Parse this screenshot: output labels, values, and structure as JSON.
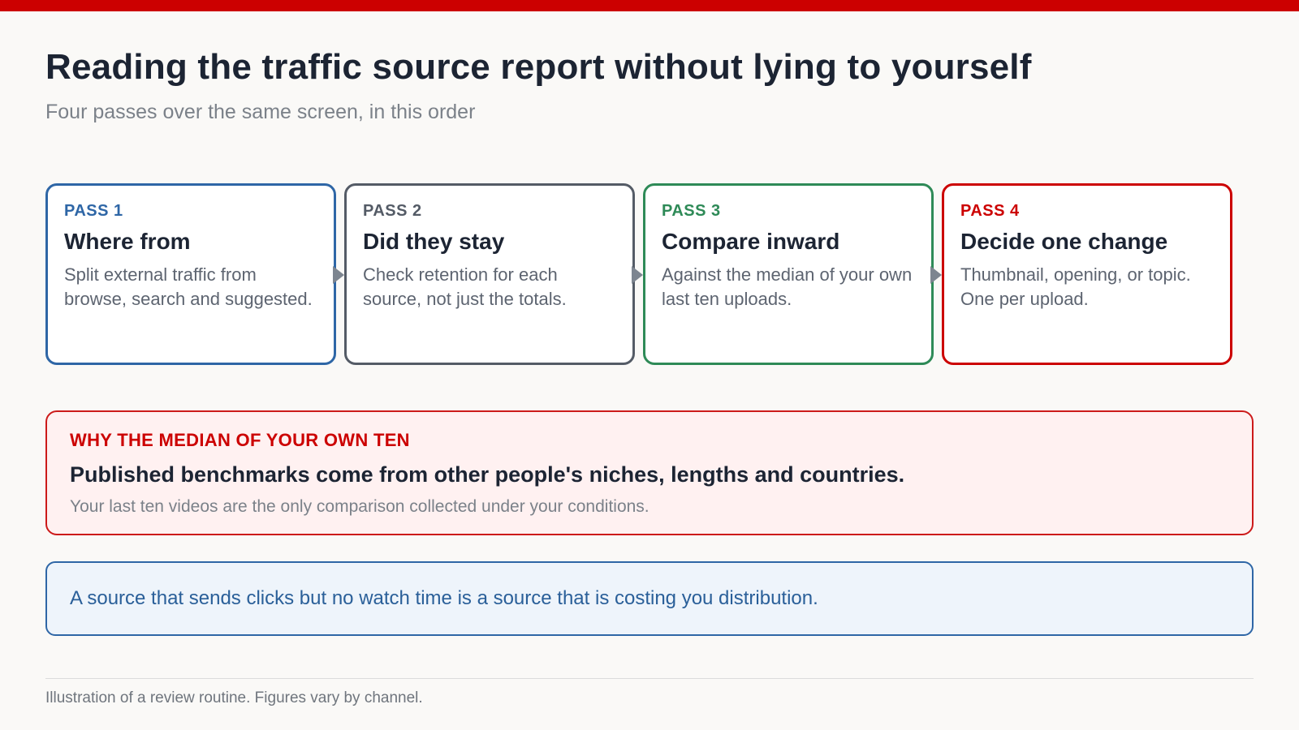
{
  "header": {
    "title": "Reading the traffic source report without lying to yourself",
    "subtitle": "Four passes over the same screen, in this order"
  },
  "passes": [
    {
      "label": "PASS 1",
      "title": "Where from",
      "desc": "Split external traffic from browse, search and suggested.",
      "color": "#2e66a6"
    },
    {
      "label": "PASS 2",
      "title": "Did they stay",
      "desc": "Check retention for each source, not just the totals.",
      "color": "#545b66"
    },
    {
      "label": "PASS 3",
      "title": "Compare inward",
      "desc": "Against the median of your own last ten uploads.",
      "color": "#2e8a57"
    },
    {
      "label": "PASS 4",
      "title": "Decide one change",
      "desc": "Thumbnail, opening, or topic. One per upload.",
      "color": "#cc0000"
    }
  ],
  "callout": {
    "label": "WHY THE MEDIAN OF YOUR OWN TEN",
    "headline": "Published benchmarks come from other people's niches, lengths and countries.",
    "body": "Your last ten videos are the only comparison collected under your conditions."
  },
  "note": {
    "text": "A source that sends clicks but no watch time is a source that is costing you distribution."
  },
  "footer": {
    "text": "Illustration of a review routine. Figures vary by channel."
  }
}
